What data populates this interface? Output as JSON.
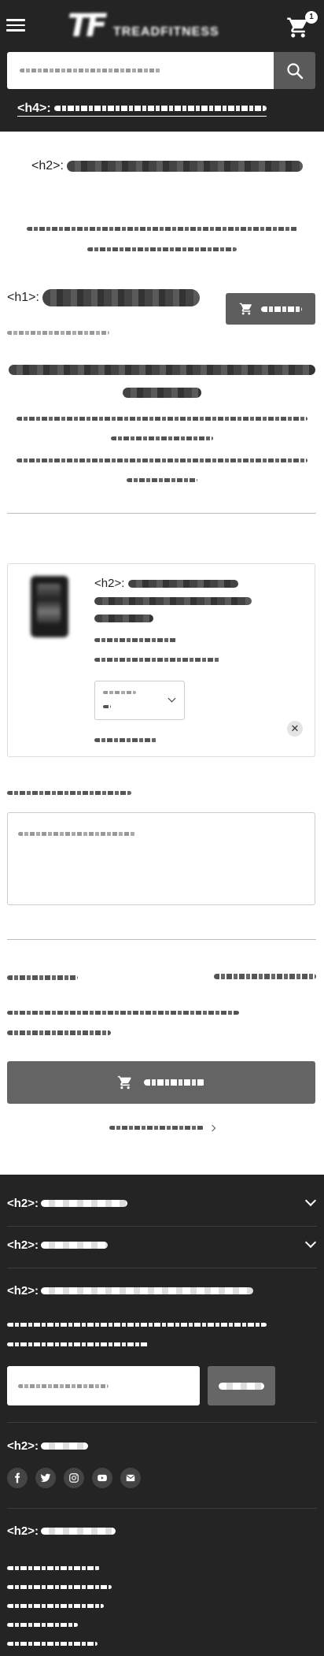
{
  "header": {
    "logo_letters": "TF",
    "logo_word": "TREADFITNESS",
    "cart_count": "1",
    "promo_heading_tag": "<h4>:"
  },
  "cart_page": {
    "section_heading_tag": "<h2>:",
    "page_heading_tag": "<h1>:"
  },
  "item": {
    "heading_tag": "<h2>:"
  },
  "footer": {
    "heading_tag": "<h2>:"
  }
}
